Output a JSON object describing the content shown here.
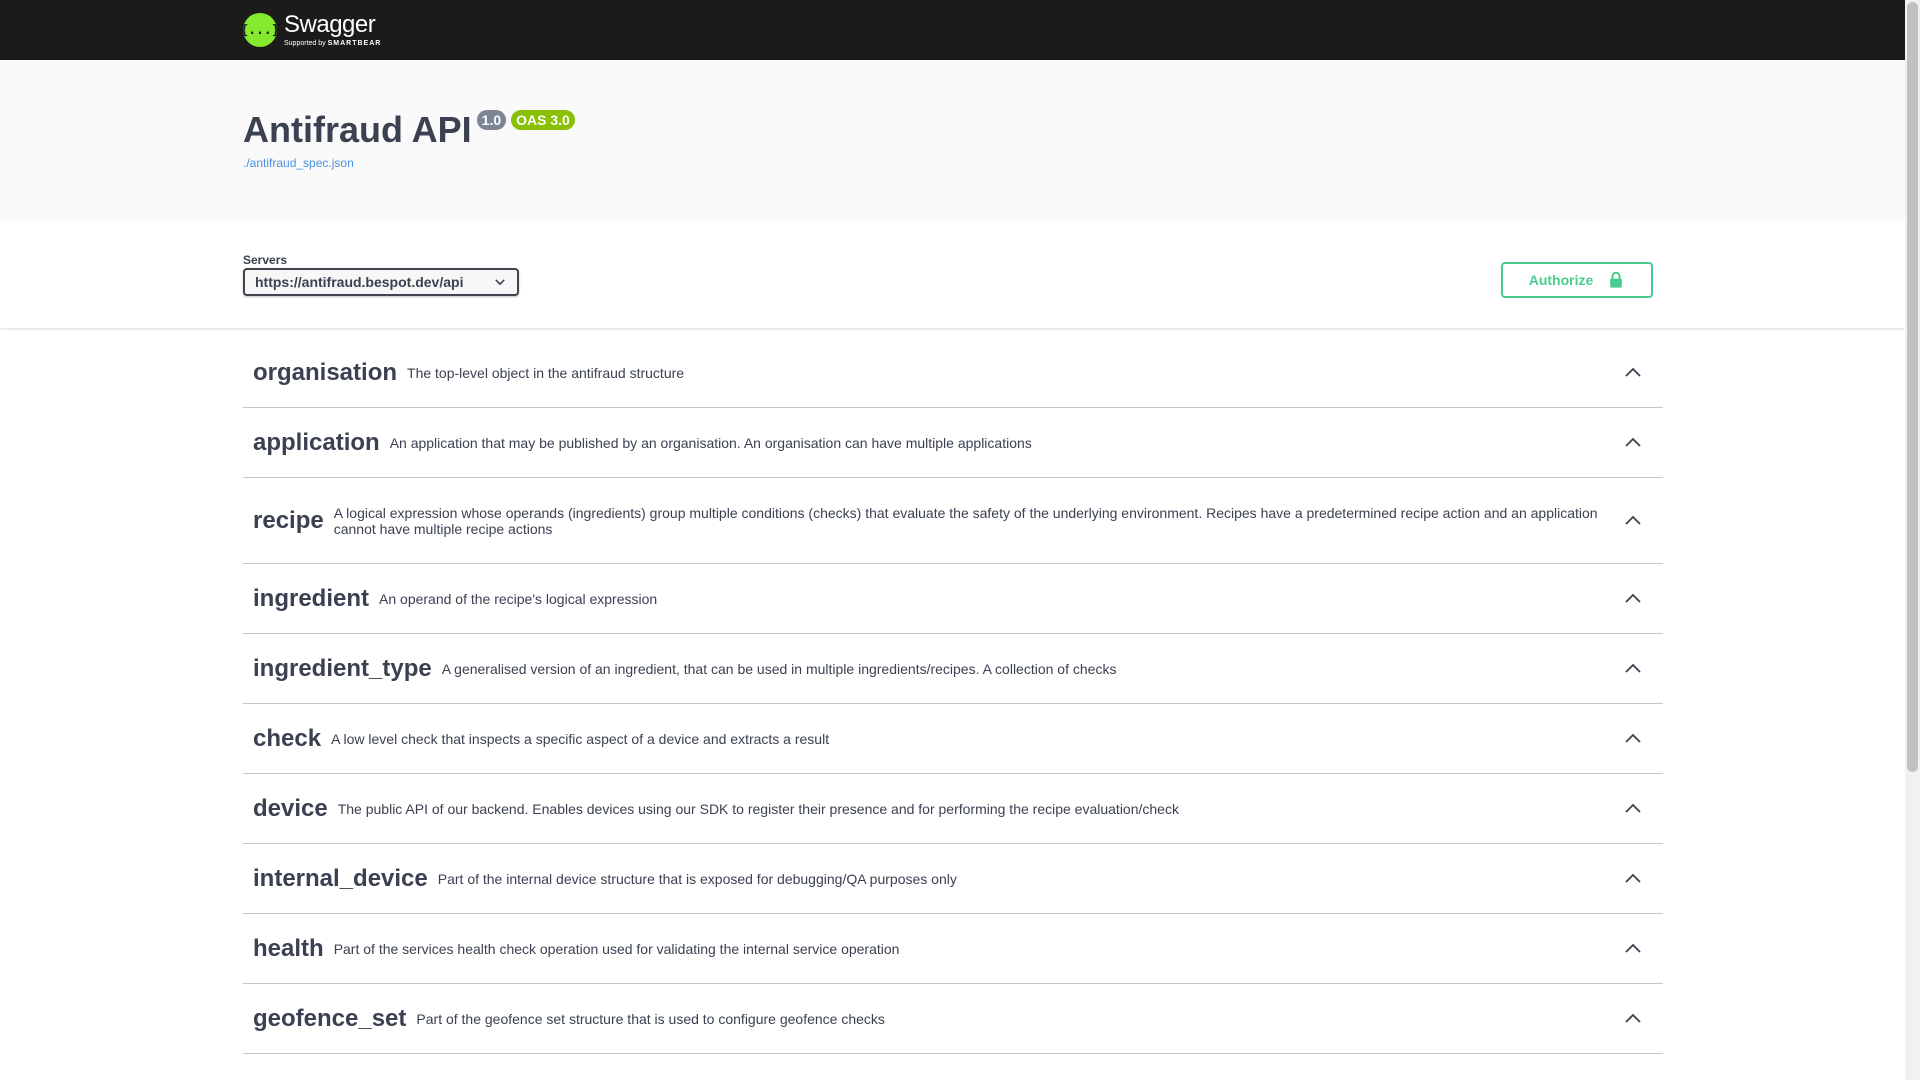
{
  "topbar": {
    "logo_symbol": "{...}",
    "brand_name": "Swagger",
    "brand_sub_prefix": "Supported by",
    "brand_sub_company": "SMARTBEAR",
    "logo_color": "#85ea2d"
  },
  "info": {
    "title": "Antifraud API",
    "version_badge": "1.0",
    "oas_badge": "OAS 3.0",
    "spec_link": "./antifraud_spec.json"
  },
  "servers": {
    "label": "Servers",
    "selected": "https://antifraud.bespot.dev/api"
  },
  "authorize": {
    "label": "Authorize",
    "color": "#49cc90",
    "icon": "lock-icon"
  },
  "tags": [
    {
      "name": "organisation",
      "description": "The top-level object in the antifraud structure"
    },
    {
      "name": "application",
      "description": "An application that may be published by an organisation. An organisation can have multiple applications"
    },
    {
      "name": "recipe",
      "description": "A logical expression whose operands (ingredients) group multiple conditions (checks) that evaluate the safety of the underlying environment. Recipes have a predetermined recipe action and an application cannot have multiple recipe actions"
    },
    {
      "name": "ingredient",
      "description": "An operand of the recipe's logical expression"
    },
    {
      "name": "ingredient_type",
      "description": "A generalised version of an ingredient, that can be used in multiple ingredients/recipes. A collection of checks"
    },
    {
      "name": "check",
      "description": "A low level check that inspects a specific aspect of a device and extracts a result"
    },
    {
      "name": "device",
      "description": "The public API of our backend. Enables devices using our SDK to register their presence and for performing the recipe evaluation/check"
    },
    {
      "name": "internal_device",
      "description": "Part of the internal device structure that is exposed for debugging/QA purposes only"
    },
    {
      "name": "health",
      "description": "Part of the services health check operation used for validating the internal service operation"
    },
    {
      "name": "geofence_set",
      "description": "Part of the geofence set structure that is used to configure geofence checks"
    }
  ]
}
